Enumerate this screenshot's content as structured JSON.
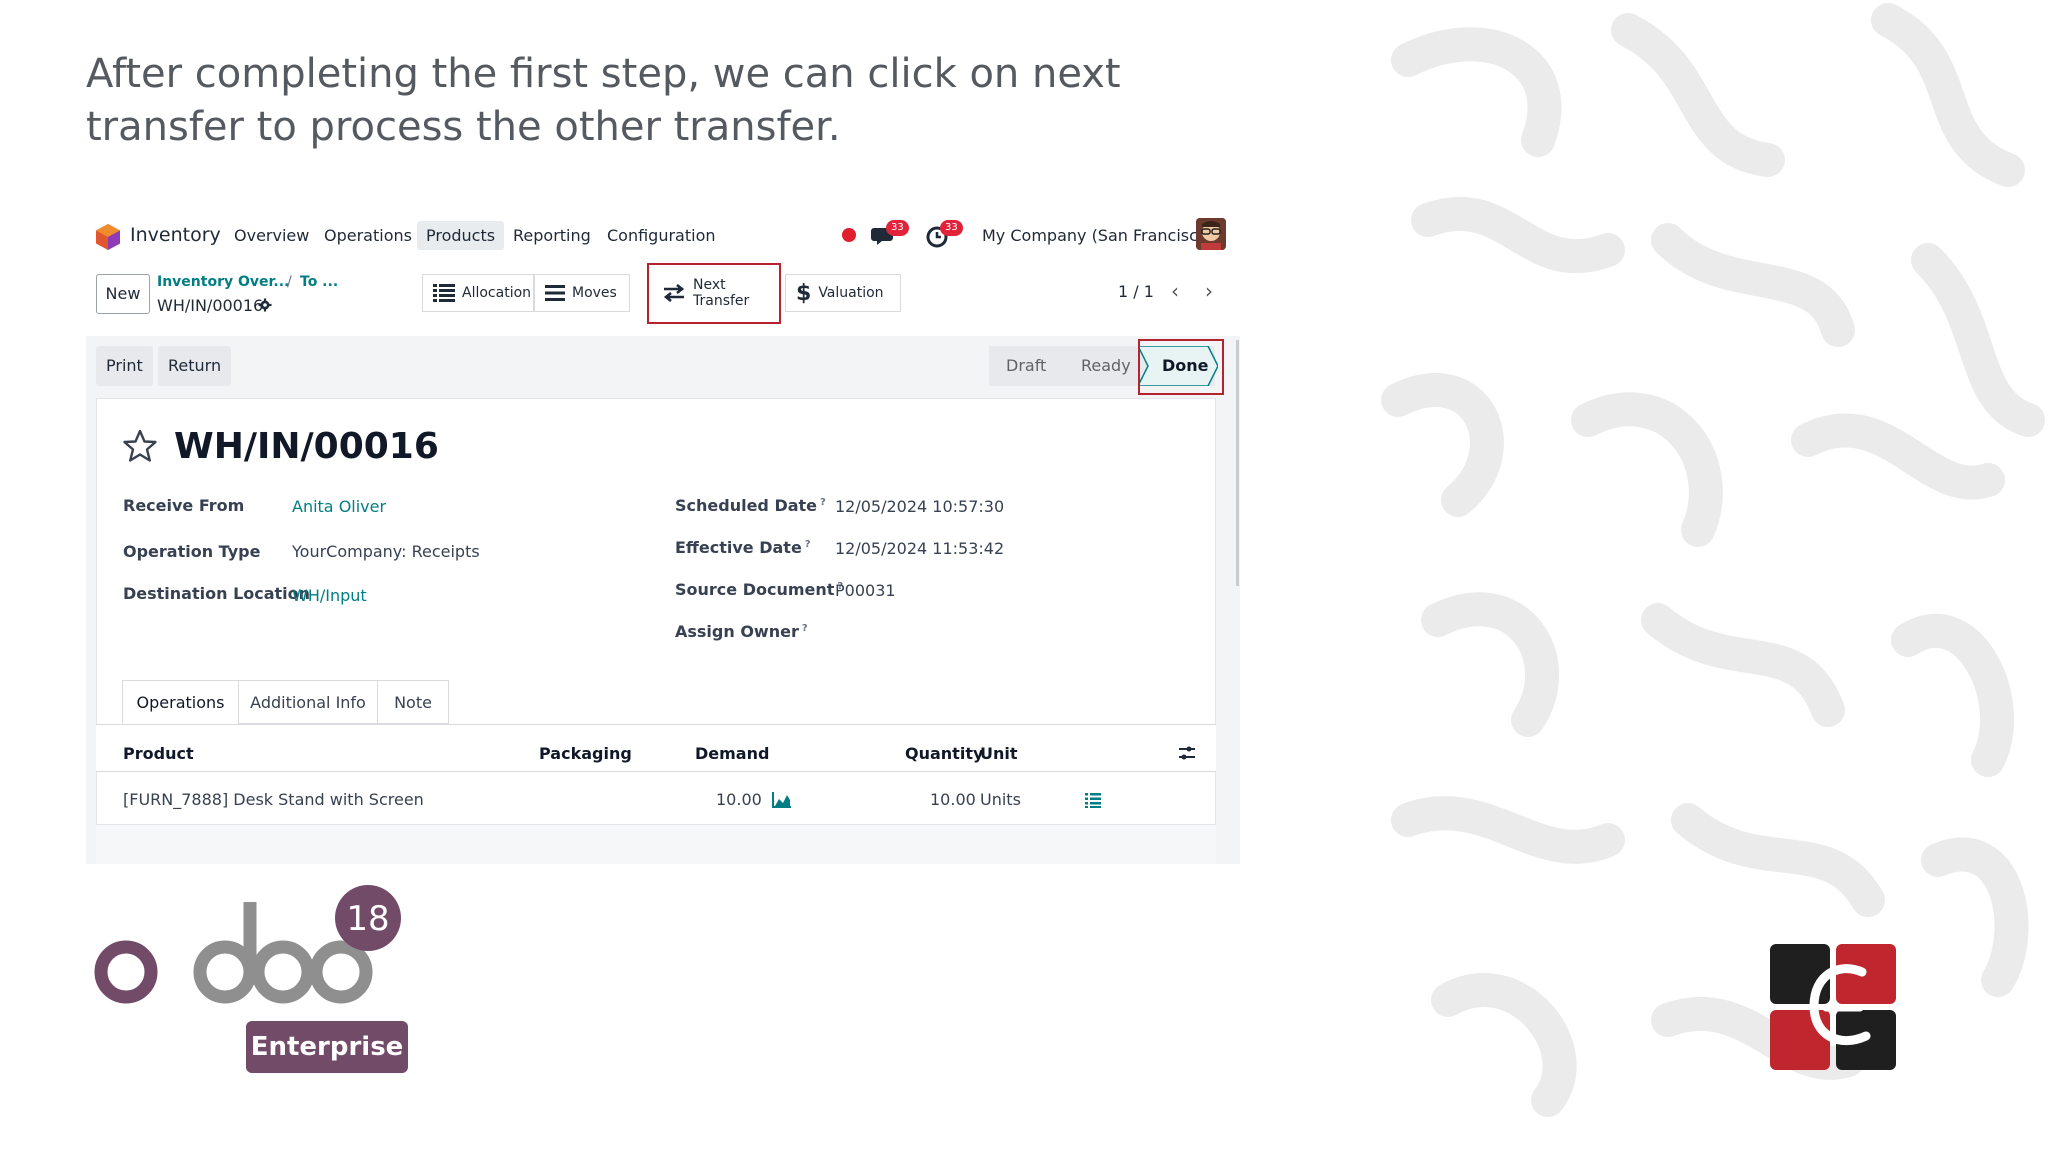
{
  "caption": "After completing the first step, we can click on next transfer to process the other transfer.",
  "navbar": {
    "app_name": "Inventory",
    "menu": [
      "Overview",
      "Operations",
      "Products",
      "Reporting",
      "Configuration"
    ],
    "active_menu": "Products",
    "messages_count": "33",
    "activities_count": "33",
    "company": "My Company (San Francisco)"
  },
  "control": {
    "new_label": "New",
    "breadcrumb": [
      "Inventory Over...",
      "To ..."
    ],
    "breadcrumb_sep": "/",
    "record": "WH/IN/00016",
    "smart_buttons": {
      "allocation": "Allocation",
      "moves": "Moves",
      "next_transfer": "Next Transfer",
      "valuation": "Valuation"
    },
    "pager": "1 / 1"
  },
  "actions": {
    "print": "Print",
    "return": "Return"
  },
  "statusbar": {
    "draft": "Draft",
    "ready": "Ready",
    "done": "Done",
    "current": "Done"
  },
  "form": {
    "title": "WH/IN/00016",
    "fields_left": [
      {
        "label": "Receive From",
        "value": "Anita Oliver"
      },
      {
        "label": "Operation Type",
        "value": "YourCompany: Receipts"
      },
      {
        "label": "Destination Location",
        "value": "WH/Input"
      }
    ],
    "fields_right": [
      {
        "label": "Scheduled Date",
        "value": "12/05/2024 10:57:30"
      },
      {
        "label": "Effective Date",
        "value": "12/05/2024 11:53:42"
      },
      {
        "label": "Source Document",
        "value": "P00031"
      },
      {
        "label": "Assign Owner",
        "value": ""
      }
    ],
    "help_mark": "?"
  },
  "tabs": [
    "Operations",
    "Additional Info",
    "Note"
  ],
  "table": {
    "columns": [
      "Product",
      "Packaging",
      "Demand",
      "Quantity",
      "Unit"
    ],
    "rows": [
      {
        "product": "[FURN_7888] Desk Stand with Screen",
        "packaging": "",
        "demand": "10.00",
        "quantity": "10.00",
        "unit": "Units"
      }
    ]
  },
  "branding": {
    "version": "18",
    "edition": "Enterprise"
  },
  "colors": {
    "accent": "#017e84",
    "brand": "#714b67",
    "highlight": "#b5232f"
  }
}
